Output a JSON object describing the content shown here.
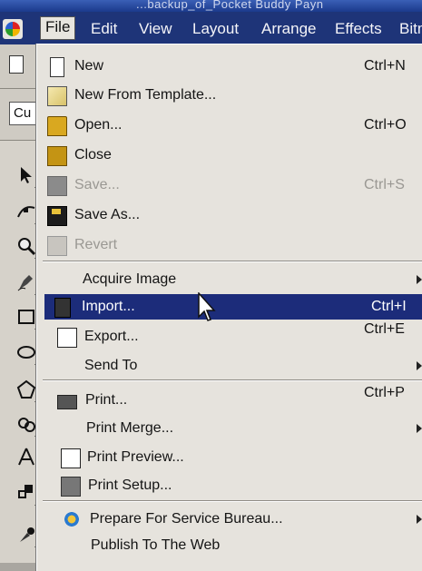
{
  "titlebar": {
    "title": "...backup_of_Pocket Buddy Payn"
  },
  "menubar": {
    "items": [
      {
        "label": "File"
      },
      {
        "label": "Edit"
      },
      {
        "label": "View"
      },
      {
        "label": "Layout"
      },
      {
        "label": "Arrange"
      },
      {
        "label": "Effects"
      },
      {
        "label": "Bitm"
      }
    ]
  },
  "propbar": {
    "field_value": "Cu"
  },
  "file_menu": {
    "items": [
      {
        "label": "New",
        "shortcut": "Ctrl+N",
        "icon": "new-document-icon"
      },
      {
        "label": "New From Template...",
        "shortcut": "",
        "icon": "template-icon"
      },
      {
        "label": "Open...",
        "shortcut": "Ctrl+O",
        "icon": "open-folder-icon"
      },
      {
        "label": "Close",
        "shortcut": "",
        "icon": "close-folder-icon"
      },
      {
        "label": "Save...",
        "shortcut": "Ctrl+S",
        "icon": "save-icon",
        "disabled": true
      },
      {
        "label": "Save As...",
        "shortcut": "",
        "icon": "save-as-icon"
      },
      {
        "label": "Revert",
        "shortcut": "",
        "icon": "revert-icon",
        "disabled": true
      },
      {
        "label": "Acquire Image",
        "shortcut": "",
        "submenu": true
      },
      {
        "label": "Import...",
        "shortcut": "Ctrl+I",
        "icon": "import-icon",
        "highlighted": true
      },
      {
        "label": "Export...",
        "shortcut": "Ctrl+E",
        "icon": "export-icon"
      },
      {
        "label": "Send To",
        "shortcut": "",
        "submenu": true
      },
      {
        "label": "Print...",
        "shortcut": "Ctrl+P",
        "icon": "printer-icon"
      },
      {
        "label": "Print Merge...",
        "shortcut": "",
        "submenu": true
      },
      {
        "label": "Print Preview...",
        "shortcut": "",
        "icon": "print-preview-icon"
      },
      {
        "label": "Print Setup...",
        "shortcut": "",
        "icon": "print-setup-icon"
      },
      {
        "label": "Prepare For Service Bureau...",
        "shortcut": "",
        "icon": "service-bureau-icon",
        "submenu": true
      },
      {
        "label": "Publish To The Web",
        "shortcut": ""
      }
    ]
  },
  "colors": {
    "menubar_bg": "#1e3478",
    "menu_bg": "#e6e3dd",
    "highlight_bg": "#1c2c7a",
    "disabled_text": "#9a9893"
  }
}
